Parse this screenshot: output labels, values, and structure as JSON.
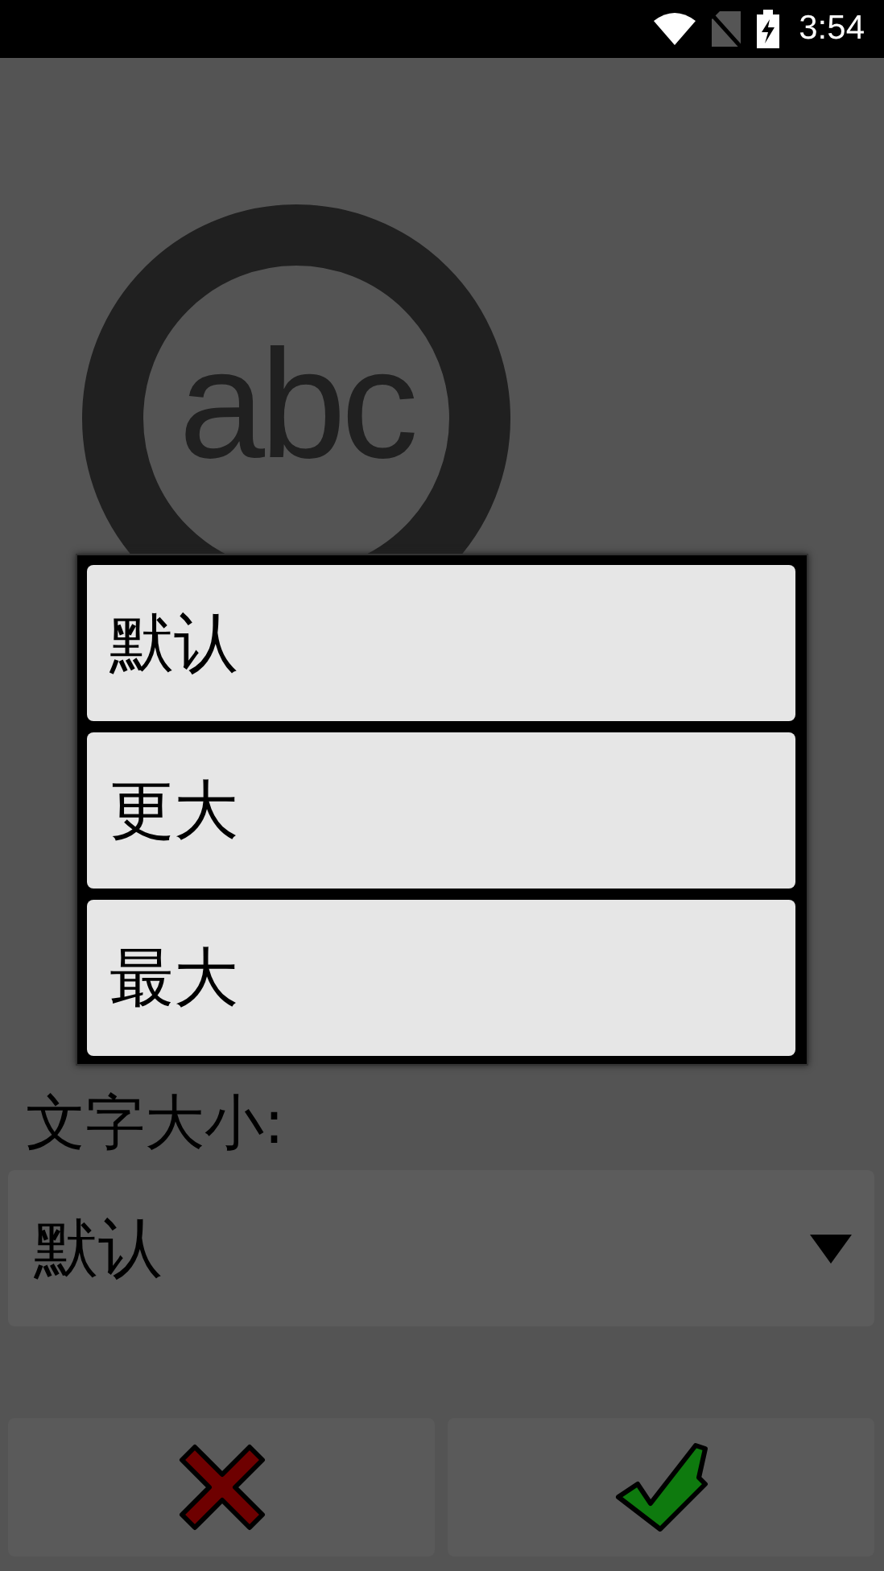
{
  "status_bar": {
    "time": "3:54"
  },
  "logo": {
    "text": "abc"
  },
  "setting": {
    "label": "文字大小:",
    "value": "默认"
  },
  "dialog": {
    "options": [
      {
        "label": "默认"
      },
      {
        "label": "更大"
      },
      {
        "label": "最大"
      }
    ]
  },
  "buttons": [
    {
      "kind": "cancel"
    },
    {
      "kind": "confirm"
    }
  ]
}
